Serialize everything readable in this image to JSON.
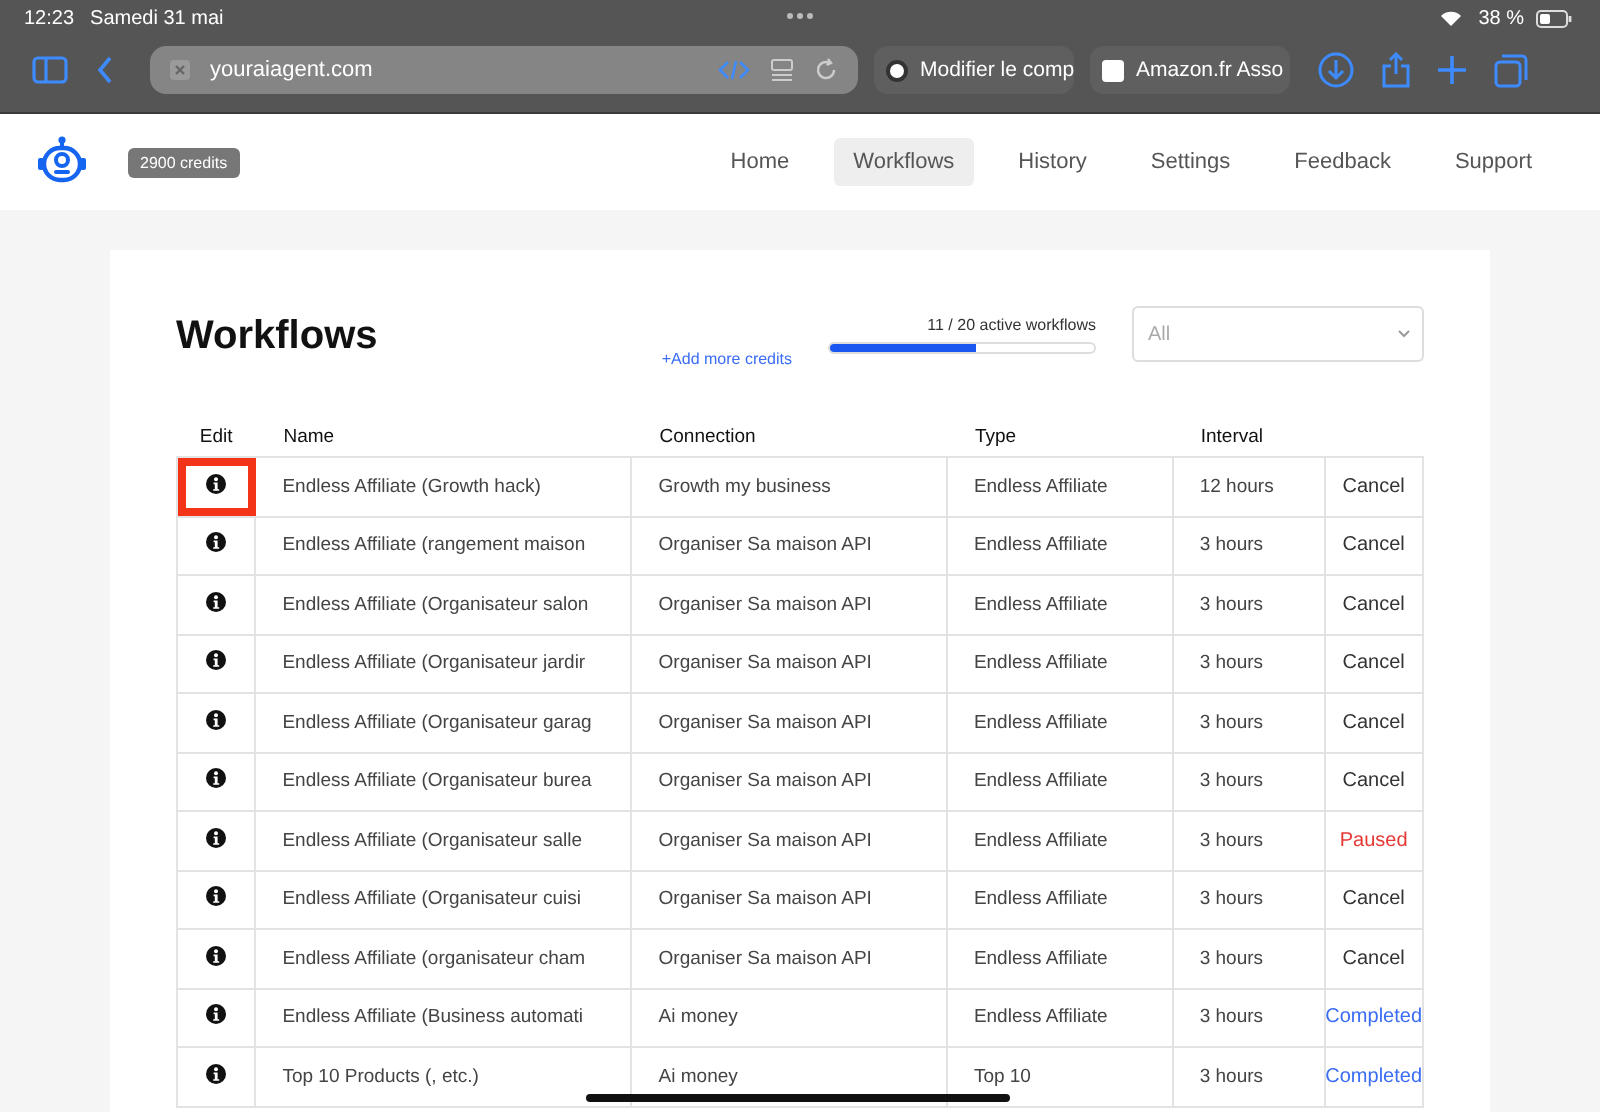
{
  "status_bar": {
    "time": "12:23",
    "date": "Samedi 31 mai",
    "battery": "38 %"
  },
  "browser": {
    "url": "youraiagent.com",
    "tabs": [
      {
        "label": "Modifier le comp",
        "kind": "wordpress"
      },
      {
        "label": "Amazon.fr Asso",
        "kind": "amazon"
      }
    ]
  },
  "nav": {
    "credits": "2900 credits",
    "items": [
      {
        "label": "Home",
        "selected": false
      },
      {
        "label": "Workflows",
        "selected": true
      },
      {
        "label": "History",
        "selected": false
      },
      {
        "label": "Settings",
        "selected": false
      },
      {
        "label": "Feedback",
        "selected": false
      },
      {
        "label": "Support",
        "selected": false
      }
    ]
  },
  "page": {
    "title": "Workflows",
    "add_credits": "+Add more credits",
    "usage": "11 / 20 active workflows",
    "level": 0.55,
    "filter": {
      "value": "All"
    }
  },
  "table": {
    "columns": [
      "Edit",
      "Name",
      "Connection",
      "Type",
      "Interval"
    ],
    "rows": [
      {
        "name": "Endless Affiliate (Growth hack)",
        "connection": "Growth my business",
        "type": "Endless Affiliate",
        "interval": "12 hours",
        "action": "Cancel",
        "kind": "cancel",
        "highlighted": true
      },
      {
        "name": "Endless Affiliate (rangement maison",
        "connection": "Organiser Sa maison API",
        "type": "Endless Affiliate",
        "interval": "3 hours",
        "action": "Cancel",
        "kind": "cancel",
        "highlighted": false
      },
      {
        "name": "Endless Affiliate (Organisateur salon",
        "connection": "Organiser Sa maison API",
        "type": "Endless Affiliate",
        "interval": "3 hours",
        "action": "Cancel",
        "kind": "cancel",
        "highlighted": false
      },
      {
        "name": "Endless Affiliate (Organisateur jardir",
        "connection": "Organiser Sa maison API",
        "type": "Endless Affiliate",
        "interval": "3 hours",
        "action": "Cancel",
        "kind": "cancel",
        "highlighted": false
      },
      {
        "name": "Endless Affiliate (Organisateur garag",
        "connection": "Organiser Sa maison API",
        "type": "Endless Affiliate",
        "interval": "3 hours",
        "action": "Cancel",
        "kind": "cancel",
        "highlighted": false
      },
      {
        "name": "Endless Affiliate (Organisateur burea",
        "connection": "Organiser Sa maison API",
        "type": "Endless Affiliate",
        "interval": "3 hours",
        "action": "Cancel",
        "kind": "cancel",
        "highlighted": false
      },
      {
        "name": "Endless Affiliate (Organisateur salle",
        "connection": "Organiser Sa maison API",
        "type": "Endless Affiliate",
        "interval": "3 hours",
        "action": "Paused",
        "kind": "paused",
        "highlighted": false
      },
      {
        "name": "Endless Affiliate (Organisateur cuisi",
        "connection": "Organiser Sa maison API",
        "type": "Endless Affiliate",
        "interval": "3 hours",
        "action": "Cancel",
        "kind": "cancel",
        "highlighted": false
      },
      {
        "name": "Endless Affiliate (organisateur cham",
        "connection": "Organiser Sa maison API",
        "type": "Endless Affiliate",
        "interval": "3 hours",
        "action": "Cancel",
        "kind": "cancel",
        "highlighted": false
      },
      {
        "name": "Endless Affiliate (Business automati",
        "connection": "Ai money",
        "type": "Endless Affiliate",
        "interval": "3 hours",
        "action": "Completed",
        "kind": "completed",
        "highlighted": false
      },
      {
        "name": "Top 10 Products (, etc.)",
        "connection": "Ai money",
        "type": "Top 10",
        "interval": "3 hours",
        "action": "Completed",
        "kind": "completed",
        "highlighted": false
      }
    ]
  }
}
